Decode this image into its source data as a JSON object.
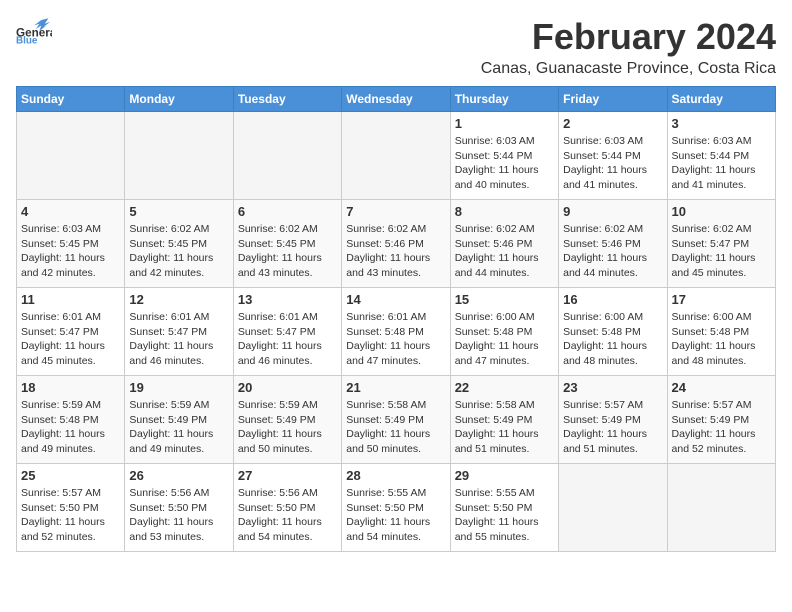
{
  "logo": {
    "line1": "General",
    "line2": "Blue"
  },
  "title": "February 2024",
  "location": "Canas, Guanacaste Province, Costa Rica",
  "days_of_week": [
    "Sunday",
    "Monday",
    "Tuesday",
    "Wednesday",
    "Thursday",
    "Friday",
    "Saturday"
  ],
  "weeks": [
    [
      {
        "day": "",
        "info": ""
      },
      {
        "day": "",
        "info": ""
      },
      {
        "day": "",
        "info": ""
      },
      {
        "day": "",
        "info": ""
      },
      {
        "day": "1",
        "info": "Sunrise: 6:03 AM\nSunset: 5:44 PM\nDaylight: 11 hours\nand 40 minutes."
      },
      {
        "day": "2",
        "info": "Sunrise: 6:03 AM\nSunset: 5:44 PM\nDaylight: 11 hours\nand 41 minutes."
      },
      {
        "day": "3",
        "info": "Sunrise: 6:03 AM\nSunset: 5:44 PM\nDaylight: 11 hours\nand 41 minutes."
      }
    ],
    [
      {
        "day": "4",
        "info": "Sunrise: 6:03 AM\nSunset: 5:45 PM\nDaylight: 11 hours\nand 42 minutes."
      },
      {
        "day": "5",
        "info": "Sunrise: 6:02 AM\nSunset: 5:45 PM\nDaylight: 11 hours\nand 42 minutes."
      },
      {
        "day": "6",
        "info": "Sunrise: 6:02 AM\nSunset: 5:45 PM\nDaylight: 11 hours\nand 43 minutes."
      },
      {
        "day": "7",
        "info": "Sunrise: 6:02 AM\nSunset: 5:46 PM\nDaylight: 11 hours\nand 43 minutes."
      },
      {
        "day": "8",
        "info": "Sunrise: 6:02 AM\nSunset: 5:46 PM\nDaylight: 11 hours\nand 44 minutes."
      },
      {
        "day": "9",
        "info": "Sunrise: 6:02 AM\nSunset: 5:46 PM\nDaylight: 11 hours\nand 44 minutes."
      },
      {
        "day": "10",
        "info": "Sunrise: 6:02 AM\nSunset: 5:47 PM\nDaylight: 11 hours\nand 45 minutes."
      }
    ],
    [
      {
        "day": "11",
        "info": "Sunrise: 6:01 AM\nSunset: 5:47 PM\nDaylight: 11 hours\nand 45 minutes."
      },
      {
        "day": "12",
        "info": "Sunrise: 6:01 AM\nSunset: 5:47 PM\nDaylight: 11 hours\nand 46 minutes."
      },
      {
        "day": "13",
        "info": "Sunrise: 6:01 AM\nSunset: 5:47 PM\nDaylight: 11 hours\nand 46 minutes."
      },
      {
        "day": "14",
        "info": "Sunrise: 6:01 AM\nSunset: 5:48 PM\nDaylight: 11 hours\nand 47 minutes."
      },
      {
        "day": "15",
        "info": "Sunrise: 6:00 AM\nSunset: 5:48 PM\nDaylight: 11 hours\nand 47 minutes."
      },
      {
        "day": "16",
        "info": "Sunrise: 6:00 AM\nSunset: 5:48 PM\nDaylight: 11 hours\nand 48 minutes."
      },
      {
        "day": "17",
        "info": "Sunrise: 6:00 AM\nSunset: 5:48 PM\nDaylight: 11 hours\nand 48 minutes."
      }
    ],
    [
      {
        "day": "18",
        "info": "Sunrise: 5:59 AM\nSunset: 5:48 PM\nDaylight: 11 hours\nand 49 minutes."
      },
      {
        "day": "19",
        "info": "Sunrise: 5:59 AM\nSunset: 5:49 PM\nDaylight: 11 hours\nand 49 minutes."
      },
      {
        "day": "20",
        "info": "Sunrise: 5:59 AM\nSunset: 5:49 PM\nDaylight: 11 hours\nand 50 minutes."
      },
      {
        "day": "21",
        "info": "Sunrise: 5:58 AM\nSunset: 5:49 PM\nDaylight: 11 hours\nand 50 minutes."
      },
      {
        "day": "22",
        "info": "Sunrise: 5:58 AM\nSunset: 5:49 PM\nDaylight: 11 hours\nand 51 minutes."
      },
      {
        "day": "23",
        "info": "Sunrise: 5:57 AM\nSunset: 5:49 PM\nDaylight: 11 hours\nand 51 minutes."
      },
      {
        "day": "24",
        "info": "Sunrise: 5:57 AM\nSunset: 5:49 PM\nDaylight: 11 hours\nand 52 minutes."
      }
    ],
    [
      {
        "day": "25",
        "info": "Sunrise: 5:57 AM\nSunset: 5:50 PM\nDaylight: 11 hours\nand 52 minutes."
      },
      {
        "day": "26",
        "info": "Sunrise: 5:56 AM\nSunset: 5:50 PM\nDaylight: 11 hours\nand 53 minutes."
      },
      {
        "day": "27",
        "info": "Sunrise: 5:56 AM\nSunset: 5:50 PM\nDaylight: 11 hours\nand 54 minutes."
      },
      {
        "day": "28",
        "info": "Sunrise: 5:55 AM\nSunset: 5:50 PM\nDaylight: 11 hours\nand 54 minutes."
      },
      {
        "day": "29",
        "info": "Sunrise: 5:55 AM\nSunset: 5:50 PM\nDaylight: 11 hours\nand 55 minutes."
      },
      {
        "day": "",
        "info": ""
      },
      {
        "day": "",
        "info": ""
      }
    ]
  ]
}
